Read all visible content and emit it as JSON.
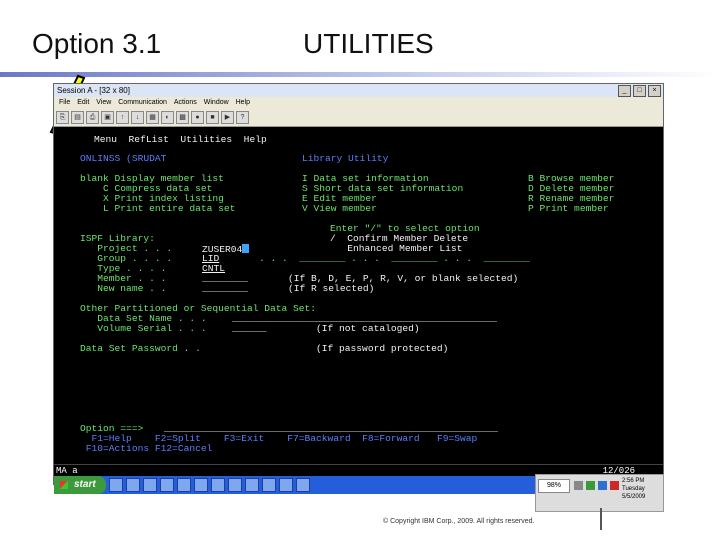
{
  "slide": {
    "title_left": "Option 3.1",
    "title_right": "UTILITIES",
    "footer": "© Copyright IBM Corp., 2009. All rights reserved."
  },
  "window": {
    "title": "Session A - [32 x 80]",
    "menu": [
      "File",
      "Edit",
      "View",
      "Communication",
      "Actions",
      "Window",
      "Help"
    ]
  },
  "terminal": {
    "menubar": "Menu  RefList  Utilities  Help",
    "panel_id": "ONLINSS (SRUDAT",
    "panel_title": "Library Utility",
    "options_left": [
      "blank Display member list",
      "    C Compress data set",
      "    X Print index listing",
      "    L Print entire data set"
    ],
    "options_mid": [
      "I Data set information",
      "S Short data set information",
      "E Edit member",
      "V View member"
    ],
    "options_right": [
      "B Browse member",
      "D Delete member",
      "R Rename member",
      "P Print member"
    ],
    "enter_hint": "Enter \"/\" to select option",
    "confirm_line": "/  Confirm Member Delete",
    "enhanced_line": "   Enhanced Member List",
    "ispf_library": "ISPF Library:",
    "project_label": "   Project . . .",
    "project_value": "ZUSER04",
    "group_label": "   Group . . . .",
    "group_value": "LID",
    "type_label": "   Type . . . .",
    "type_value": "CNTL",
    "member_label": "   Member . . .",
    "newname_label": "   New name . .",
    "member_note": "(If B, D, E, P, R, V, or blank selected)",
    "newname_note": "(If R selected)",
    "other_ds": "Other Partitioned or Sequential Data Set:",
    "dsname_label": "   Data Set Name . . .",
    "volser_label": "   Volume Serial . . .",
    "volser_note": "(If not cataloged)",
    "pwd_label": "Data Set Password . .",
    "pwd_note": "(If password protected)",
    "command_label": "Option ===>",
    "pfkeys_1": "  F1=Help    F2=Split    F3=Exit    F7=Backward  F8=Forward   F9=Swap",
    "pfkeys_2": " F10=Actions F12=Cancel"
  },
  "status": {
    "left": "MA    a",
    "cursor_pos": "12/026"
  },
  "taskbar": {
    "start": "start",
    "battery": "98%",
    "clock_time": "2:56 PM",
    "clock_day": "Tuesday",
    "clock_date": "5/5/2009"
  }
}
